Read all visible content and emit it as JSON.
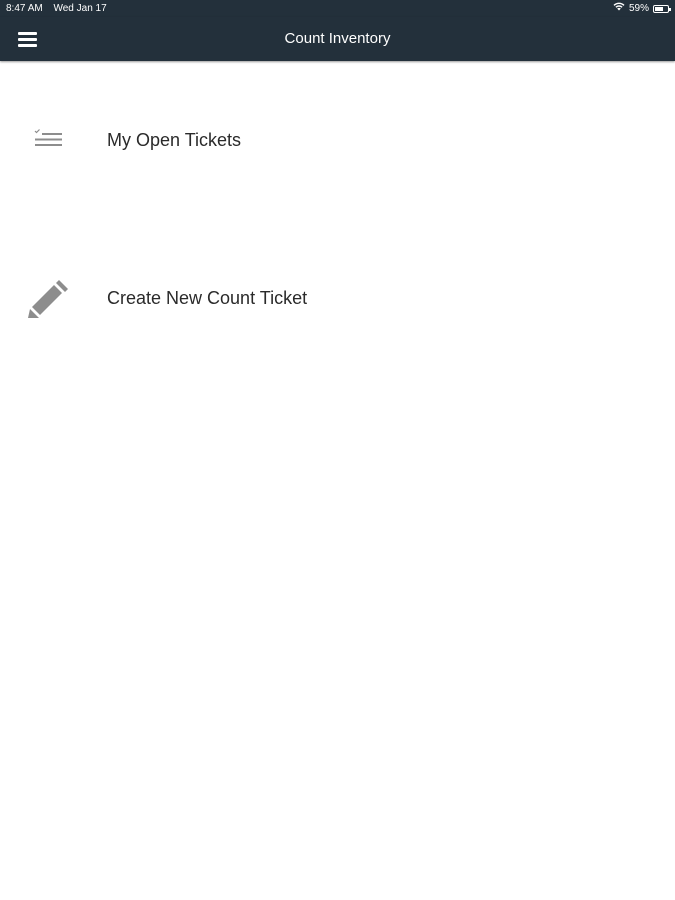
{
  "status_bar": {
    "time": "8:47 AM",
    "date": "Wed Jan 17",
    "battery_percent": "59%",
    "battery_level": 0.59
  },
  "app_bar": {
    "title": "Count Inventory",
    "menu_icon": "hamburger-menu-icon"
  },
  "menu": {
    "items": [
      {
        "label": "My Open Tickets",
        "icon": "checklist-icon"
      },
      {
        "label": "Create New Count Ticket",
        "icon": "pencil-icon"
      }
    ]
  },
  "colors": {
    "app_bar_bg": "#23303b",
    "icon_gray": "#8d8d8d",
    "text": "#2a2a2a"
  }
}
